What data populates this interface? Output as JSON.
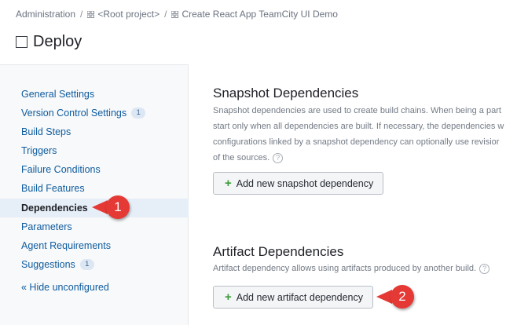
{
  "breadcrumb": {
    "admin": "Administration",
    "sep": "/",
    "root": "<Root project>",
    "project": "Create React App TeamCity UI Demo"
  },
  "page": {
    "title": "Deploy"
  },
  "sidebar": {
    "items": [
      {
        "label": "General Settings"
      },
      {
        "label": "Version Control Settings",
        "badge": "1"
      },
      {
        "label": "Build Steps"
      },
      {
        "label": "Triggers"
      },
      {
        "label": "Failure Conditions"
      },
      {
        "label": "Build Features"
      },
      {
        "label": "Dependencies",
        "active": true
      },
      {
        "label": "Parameters"
      },
      {
        "label": "Agent Requirements"
      },
      {
        "label": "Suggestions",
        "badge": "1"
      }
    ],
    "hide_link": "« Hide unconfigured"
  },
  "snapshot": {
    "title": "Snapshot Dependencies",
    "desc_lines": [
      "Snapshot dependencies are used to create build chains. When being a part",
      "start only when all dependencies are built. If necessary, the dependencies w",
      "configurations linked by a snapshot dependency can optionally use revisior",
      "of the sources."
    ],
    "button": "Add new snapshot dependency"
  },
  "artifact": {
    "title": "Artifact Dependencies",
    "desc": "Artifact dependency allows using artifacts produced by another build.",
    "button": "Add new artifact dependency"
  },
  "help_glyph": "?",
  "callouts": {
    "one": "1",
    "two": "2"
  },
  "colors": {
    "link": "#0f5b9e",
    "callout": "#e53935",
    "plus": "#3c9a3c"
  }
}
